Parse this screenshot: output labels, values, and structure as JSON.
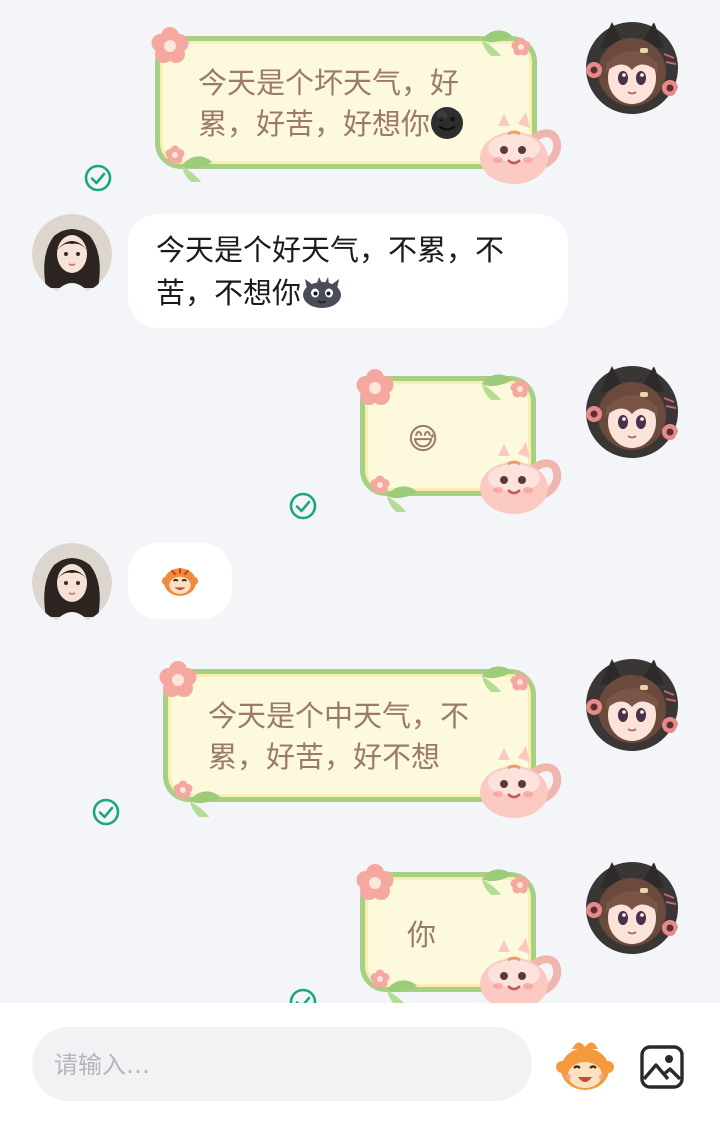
{
  "messages": [
    {
      "id": 1,
      "direction": "outgoing",
      "text": "今天是个坏天气，好累，好苦，好想你",
      "emoji": "dark-smiley",
      "status": "read"
    },
    {
      "id": 2,
      "direction": "incoming",
      "text": "今天是个好天气，不累，不苦，不想你",
      "emoji": "dark-blob"
    },
    {
      "id": 3,
      "direction": "outgoing",
      "text": "",
      "emoji": "😅",
      "status": "read"
    },
    {
      "id": 4,
      "direction": "incoming",
      "text": "",
      "emoji": "monkey-face-sticker"
    },
    {
      "id": 5,
      "direction": "outgoing",
      "text": "今天是个中天气，不累，好苦，好不想",
      "status": "read"
    },
    {
      "id": 6,
      "direction": "outgoing",
      "text": "你",
      "status": "read"
    }
  ],
  "composer": {
    "placeholder": "请输入…",
    "emoji_button_icon": "monkey-sticker-icon",
    "image_button_icon": "image-icon"
  },
  "colors": {
    "background": "#f4f5f9",
    "bubble_fill": "#fdf9dc",
    "bubble_border": "#a8cf85",
    "bubble_text": "#9b7a6c",
    "incoming_bubble": "#ffffff",
    "read_check": "#1aa683",
    "flower": "#f4a8a0"
  }
}
